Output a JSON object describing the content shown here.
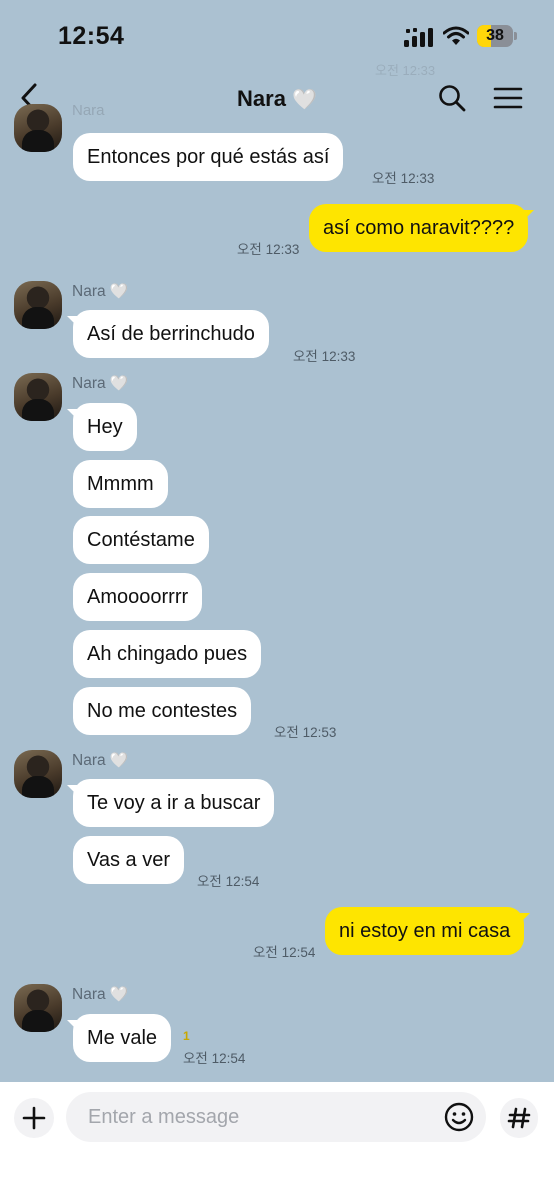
{
  "status_bar": {
    "time": "12:54",
    "battery": "38",
    "battery_level": 0.38
  },
  "header": {
    "title": "Nara",
    "title_heart": "🤍"
  },
  "sender_name": "Nara",
  "sender_heart": "🤍",
  "messages": [
    {
      "text": "Entonces por qué estás así",
      "time": "오전 12:33"
    },
    {
      "text": "así como naravit????",
      "time": "오전 12:33"
    },
    {
      "text": "Así de berrinchudo",
      "time": "오전 12:33"
    },
    {
      "text": "Hey"
    },
    {
      "text": "Mmmm"
    },
    {
      "text": "Contéstame"
    },
    {
      "text": "Amoooorrrr"
    },
    {
      "text": "Ah chingado pues"
    },
    {
      "text": "No me contestes",
      "time": "오전 12:53"
    },
    {
      "text": "Te voy a ir a buscar"
    },
    {
      "text": "Vas a ver",
      "time": "오전 12:54"
    },
    {
      "text": "ni estoy en mi casa",
      "time": "오전 12:54"
    },
    {
      "text": "Me vale",
      "time": "오전 12:54",
      "unread": "1"
    }
  ],
  "composer": {
    "placeholder": "Enter a message"
  },
  "colors": {
    "background": "#abc1d1",
    "incoming": "#ffffff",
    "outgoing": "#fee500"
  }
}
